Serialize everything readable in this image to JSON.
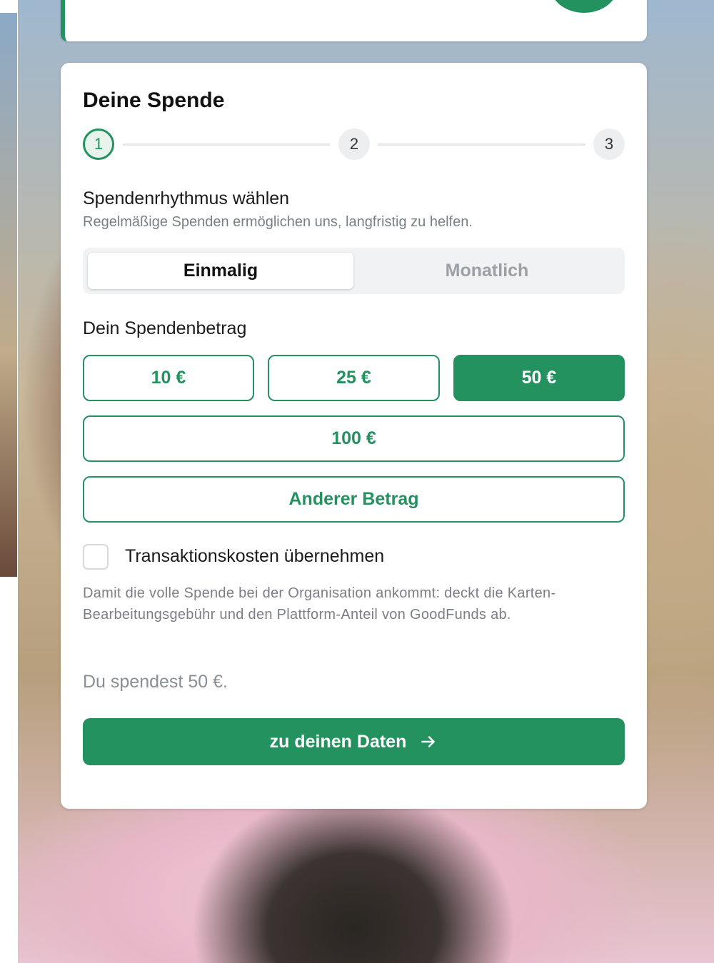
{
  "card": {
    "title": "Deine Spende",
    "steps": [
      "1",
      "2",
      "3"
    ],
    "active_step": 1
  },
  "rhythm": {
    "title": "Spendenrhythmus wählen",
    "subtitle": "Regelmäßige Spenden ermöglichen uns, langfristig zu helfen.",
    "options": [
      "Einmalig",
      "Monatlich"
    ],
    "selected": "Einmalig"
  },
  "amount": {
    "title": "Dein Spendenbetrag",
    "options": [
      "10 €",
      "25 €",
      "50 €",
      "100 €"
    ],
    "selected": "50 €",
    "other_label": "Anderer Betrag"
  },
  "fees": {
    "checkbox_label": "Transaktionskosten übernehmen",
    "checked": false,
    "info": "Damit die volle Spende bei der Organisation ankommt: deckt die Karten-Bearbeitungsgebühr und den Plattform-Anteil von GoodFunds ab."
  },
  "summary": "Du spendest 50 €.",
  "cta": {
    "label": "zu deinen Daten",
    "icon": "arrow-right-icon"
  },
  "colors": {
    "accent": "#23925f",
    "muted_text": "#7a7f85"
  }
}
